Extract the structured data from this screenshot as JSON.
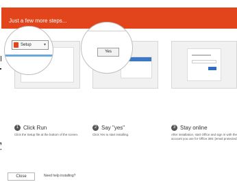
{
  "banner": {
    "title": "Just a few more steps..."
  },
  "magnifier_setup": {
    "label": "Setup"
  },
  "magnifier_yes": {
    "label": "Yes"
  },
  "steps": [
    {
      "number": "1",
      "title": "Click Run",
      "description": "Click the Setup file at the bottom of the screen."
    },
    {
      "number": "2",
      "title": "Say \"yes\"",
      "description": "Click Yes to start installing."
    },
    {
      "number": "3",
      "title": "Stay online",
      "description": "After installation, start Office and sign in with the account you use for Office 365: [email protected]."
    }
  ],
  "footer": {
    "close_label": "Close",
    "help_label": "Need help installing?"
  },
  "colors": {
    "banner": "#e2441c",
    "taskbar": "#6aa7dc"
  }
}
